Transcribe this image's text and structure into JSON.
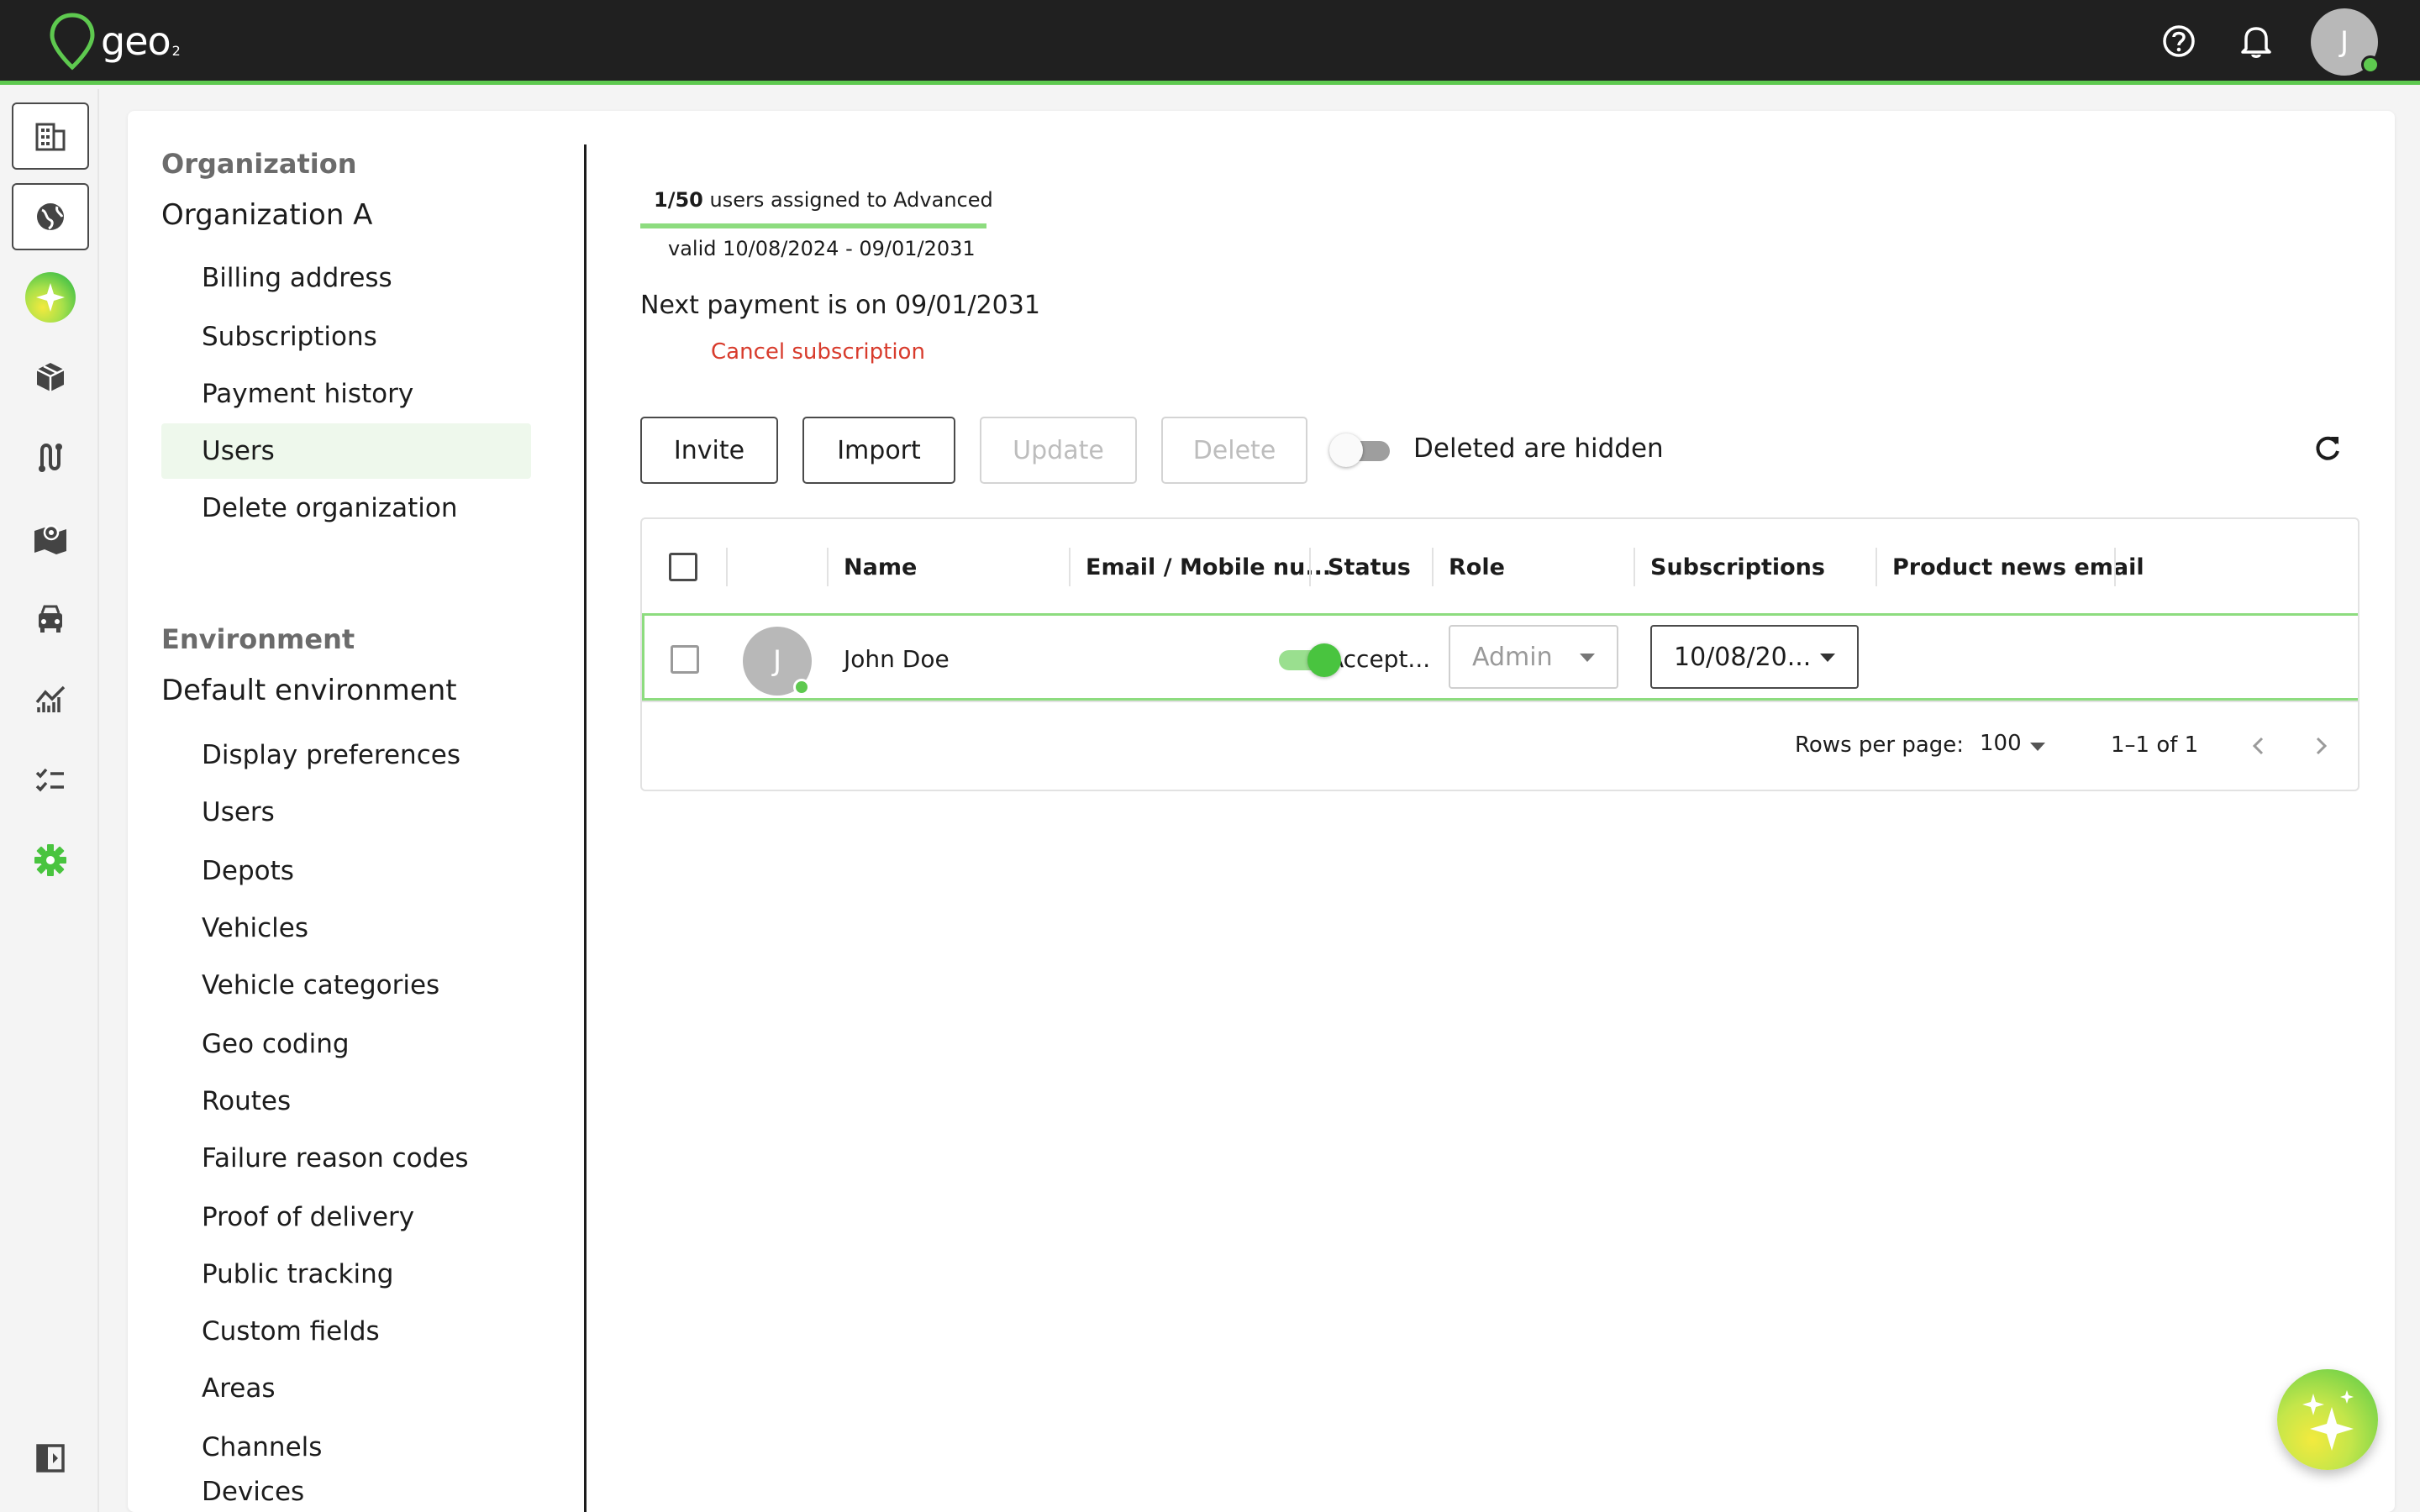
{
  "app": {
    "logo_text": "geo",
    "logo_sub": "2",
    "user_initial": "J",
    "accent_color": "#5ec94f",
    "danger_color": "#d83b2c"
  },
  "topbar": {
    "icons": [
      "help-circle-icon",
      "bell-icon"
    ]
  },
  "rail": {
    "items": [
      "organization-icon",
      "globe-icon",
      "ai-sparkle-icon",
      "package-icon",
      "route-icon",
      "map-icon",
      "vehicle-icon",
      "analytics-icon",
      "checklist-icon",
      "settings-icon",
      "collapse-sidebar-icon"
    ]
  },
  "nav": {
    "org_section": "Organization",
    "org_name": "Organization A",
    "org_items": [
      "Billing address",
      "Subscriptions",
      "Payment history",
      "Users",
      "Delete organization"
    ],
    "active_item": "Users",
    "env_section": "Environment",
    "env_name": "Default environment",
    "env_items": [
      "Display preferences",
      "Users",
      "Depots",
      "Vehicles",
      "Vehicle categories",
      "Geo coding",
      "Routes",
      "Failure reason codes",
      "Proof of delivery",
      "Public tracking",
      "Custom fields",
      "Areas",
      "Channels",
      "Devices"
    ]
  },
  "subscription": {
    "assigned_count": "1/50",
    "assigned_text": "users assigned to Advanced",
    "valid": "valid 10/08/2024 - 09/01/2031",
    "next_payment": "Next payment is on 09/01/2031",
    "cancel": "Cancel subscription"
  },
  "toolbar": {
    "invite": "Invite",
    "import": "Import",
    "update": "Update",
    "delete": "Delete",
    "deleted_toggle_label": "Deleted are hidden",
    "deleted_toggle_on": false
  },
  "table": {
    "columns": [
      "Name",
      "Email / Mobile nu...",
      "Status",
      "Role",
      "Subscriptions",
      "Product news email"
    ],
    "rows": [
      {
        "initial": "J",
        "name": "John Doe",
        "email": "",
        "status": "Accept...",
        "role": "Admin",
        "subscription": "10/08/20...",
        "product_news": true
      }
    ],
    "rows_per_page_label": "Rows per page:",
    "rows_per_page": "100",
    "range": "1–1 of 1"
  }
}
